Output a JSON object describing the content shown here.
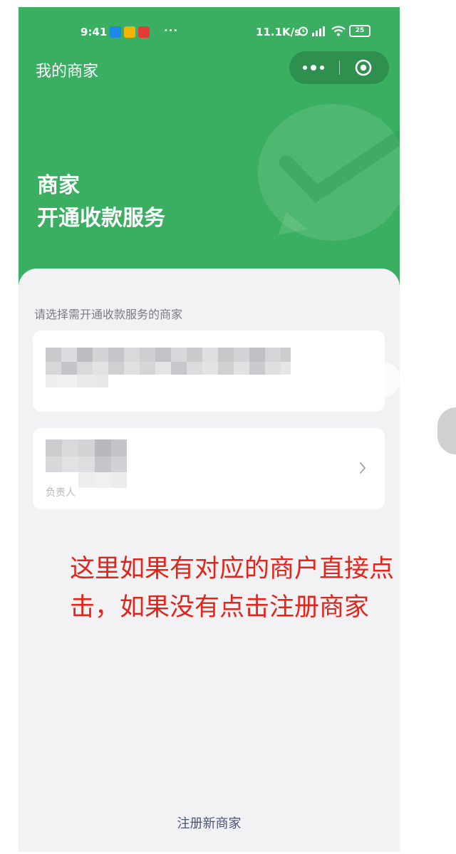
{
  "status_bar": {
    "time": "9:41",
    "more_dots": "···",
    "net_speed": "11.1K/s",
    "battery": "25",
    "icons": [
      "app-icon-blue",
      "app-icon-yellow",
      "app-icon-red",
      "alarm-icon",
      "signal-icon",
      "wifi-icon",
      "battery-icon"
    ]
  },
  "nav": {
    "title": "我的商家",
    "more_icon": "more-dots-icon",
    "close_icon": "target-icon"
  },
  "hero": {
    "line1": "商家",
    "line2": "开通收款服务"
  },
  "list": {
    "hint": "请选择需开通收款服务的商家",
    "merchants": [
      {
        "name_redacted": true,
        "chevron": false
      },
      {
        "name_redacted": true,
        "sub_label": "负责人",
        "chevron": true
      }
    ]
  },
  "annotation": {
    "line1": "这里如果有对应的商户直接点",
    "line2": "击，如果没有点击注册商家",
    "color": "#e1251b"
  },
  "footer": {
    "register_label": "注册新商家"
  },
  "colors": {
    "brand_green": "#3aaf61",
    "page_bg": "#f2f2f4",
    "link": "#4a5375"
  }
}
